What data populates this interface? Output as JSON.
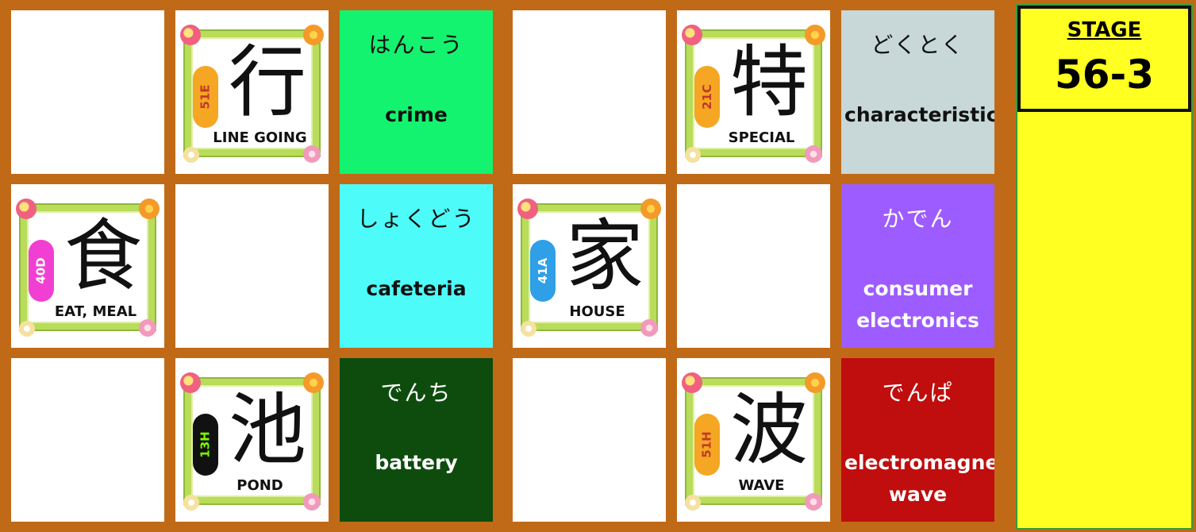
{
  "stage": {
    "label": "STAGE",
    "number": "56-3"
  },
  "cards": [
    {
      "type": "blank"
    },
    {
      "type": "kanji",
      "kanji": "行",
      "code": "51E",
      "meaning": "LINE GOING",
      "badge_color": "#f5a623",
      "badge_text_color": "#c0392b"
    },
    {
      "type": "word",
      "reading": "はんこう",
      "meaning": "crime",
      "bg": "#13f36f",
      "fg": "#111111"
    },
    {
      "type": "blank"
    },
    {
      "type": "kanji",
      "kanji": "特",
      "code": "21C",
      "meaning": "SPECIAL",
      "badge_color": "#f5a623",
      "badge_text_color": "#c0392b"
    },
    {
      "type": "word",
      "reading": "どくとく",
      "meaning": "characteristic",
      "bg": "#c8d8d8",
      "fg": "#111111"
    },
    {
      "type": "kanji",
      "kanji": "食",
      "code": "40D",
      "meaning": "EAT, MEAL",
      "badge_color": "#f23fd3",
      "badge_text_color": "#ffffff"
    },
    {
      "type": "blank"
    },
    {
      "type": "word",
      "reading": "しょくどう",
      "meaning": "cafeteria",
      "bg": "#4dfcf8",
      "fg": "#111111"
    },
    {
      "type": "kanji",
      "kanji": "家",
      "code": "41A",
      "meaning": "HOUSE",
      "badge_color": "#2f9fe8",
      "badge_text_color": "#ffffff"
    },
    {
      "type": "blank"
    },
    {
      "type": "word",
      "reading": "かでん",
      "meaning": "consumer electronics",
      "bg": "#9d5cff",
      "fg": "#ffffff"
    },
    {
      "type": "blank"
    },
    {
      "type": "kanji",
      "kanji": "池",
      "code": "13H",
      "meaning": "POND",
      "badge_color": "#111111",
      "badge_text_color": "#7cfc00"
    },
    {
      "type": "word",
      "reading": "でんち",
      "meaning": "battery",
      "bg": "#0e4c0e",
      "fg": "#ffffff"
    },
    {
      "type": "blank"
    },
    {
      "type": "kanji",
      "kanji": "波",
      "code": "51H",
      "meaning": "WAVE",
      "badge_color": "#f5a623",
      "badge_text_color": "#c0392b"
    },
    {
      "type": "word",
      "reading": "でんぱ",
      "meaning": "electromagnetic wave",
      "bg": "#c00d0d",
      "fg": "#ffffff"
    }
  ]
}
